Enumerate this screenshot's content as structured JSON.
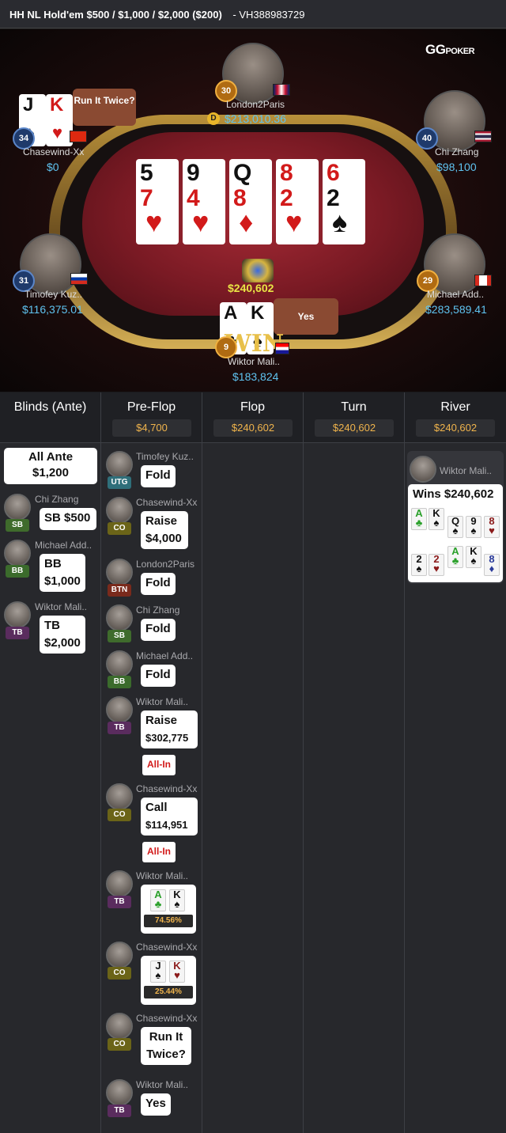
{
  "topbar": {
    "title": "HH NL Hold'em $500 / $1,000 / $2,000 ($200)",
    "hand_id": "- VH388983729"
  },
  "logo": {
    "main": "GG",
    "sub": "POKER"
  },
  "board": [
    {
      "rank1": "5",
      "rank2": "7",
      "suit": "♥",
      "color": "red"
    },
    {
      "rank1": "9",
      "rank2": "4",
      "suit": "♥",
      "color": "red"
    },
    {
      "rank1": "Q",
      "rank2": "8",
      "suit": "♦",
      "color": "red"
    },
    {
      "rank1": "8",
      "rank2": "2",
      "suit": "♥",
      "color": "red"
    },
    {
      "rank1": "6",
      "rank2": "2",
      "suit": "♠",
      "color": "black"
    }
  ],
  "pot": "$240,602",
  "seats": {
    "london": {
      "name": "London2Paris",
      "stack": "$213,010.36",
      "level": "30"
    },
    "chasewind": {
      "name": "Chasewind-Xx",
      "stack": "$0",
      "level": "34",
      "card1": "J",
      "card2": "K",
      "bubble": "Run It Twice?"
    },
    "chi": {
      "name": "Chi Zhang",
      "stack": "$98,100",
      "level": "40"
    },
    "timofey": {
      "name": "Timofey Kuz..",
      "stack": "$116,375.01",
      "level": "31"
    },
    "michael": {
      "name": "Michael Add..",
      "stack": "$283,589.41",
      "level": "29"
    },
    "wiktor": {
      "name": "Wiktor Mali..",
      "stack": "$183,824",
      "level": "9",
      "card1": "A",
      "card2": "K",
      "bubble": "Yes",
      "win": "WIN"
    }
  },
  "columns": {
    "blinds": {
      "label": "Blinds (Ante)"
    },
    "preflop": {
      "label": "Pre-Flop",
      "pot": "$4,700"
    },
    "flop": {
      "label": "Flop",
      "pot": "$240,602"
    },
    "turn": {
      "label": "Turn",
      "pot": "$240,602"
    },
    "river": {
      "label": "River",
      "pot": "$240,602"
    }
  },
  "blinds_actions": {
    "ante": {
      "line1": "All Ante",
      "line2": "$1,200"
    },
    "items": [
      {
        "name": "Chi Zhang",
        "pos": "SB",
        "line1": "SB  $500",
        "line2": ""
      },
      {
        "name": "Michael Add..",
        "pos": "BB",
        "line1": "BB",
        "line2": "$1,000"
      },
      {
        "name": "Wiktor Mali..",
        "pos": "TB",
        "line1": "TB",
        "line2": "$2,000"
      }
    ]
  },
  "preflop_actions": [
    {
      "name": "Timofey Kuz..",
      "pos": "UTG",
      "line1": "Fold",
      "line2": ""
    },
    {
      "name": "Chasewind-Xx",
      "pos": "CO",
      "line1": "Raise",
      "line2": "$4,000"
    },
    {
      "name": "London2Paris",
      "pos": "BTN",
      "line1": "Fold",
      "line2": ""
    },
    {
      "name": "Chi Zhang",
      "pos": "SB",
      "line1": "Fold",
      "line2": ""
    },
    {
      "name": "Michael Add..",
      "pos": "BB",
      "line1": "Fold",
      "line2": ""
    },
    {
      "name": "Wiktor Mali..",
      "pos": "TB",
      "line1": "Raise",
      "line2": "$302,775",
      "tag": "All-In"
    },
    {
      "name": "Chasewind-Xx",
      "pos": "CO",
      "line1": "Call",
      "line2": "$114,951",
      "tag": "All-In"
    },
    {
      "name": "Wiktor Mali..",
      "pos": "TB",
      "equity": "74.56%"
    },
    {
      "name": "Chasewind-Xx",
      "pos": "CO",
      "equity": "25.44%"
    },
    {
      "name": "Chasewind-Xx",
      "pos": "CO",
      "line1": "Run It",
      "line2": "Twice?"
    },
    {
      "name": "Wiktor Mali..",
      "pos": "TB",
      "line1": "Yes",
      "line2": ""
    }
  ],
  "river_result": {
    "name": "Wiktor Mali..",
    "wins": "Wins $240,602"
  }
}
